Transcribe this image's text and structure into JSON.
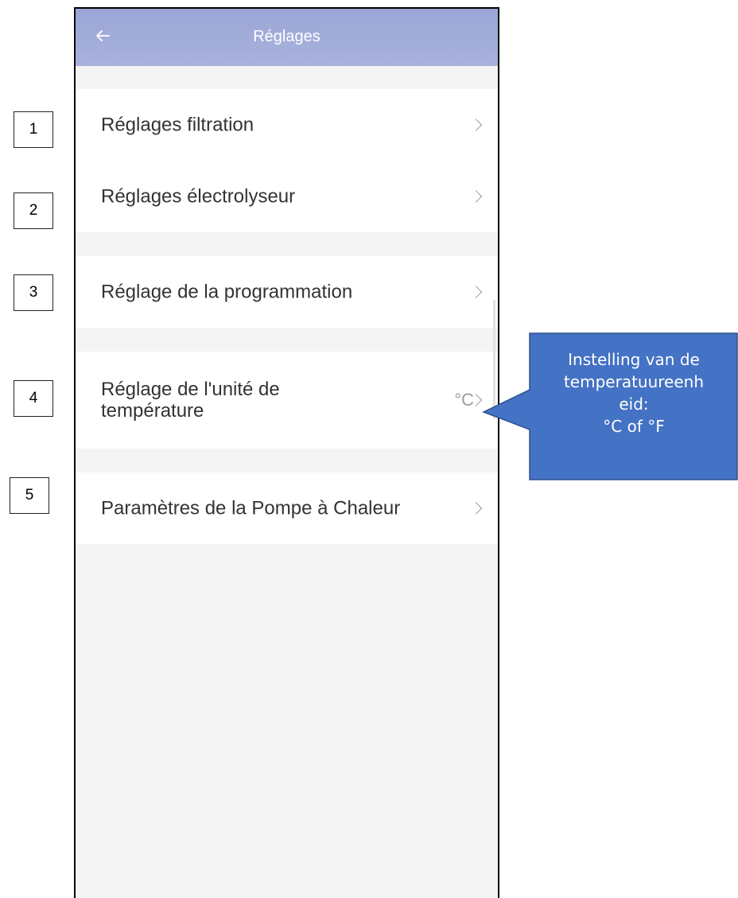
{
  "header": {
    "title": "Réglages"
  },
  "groups": [
    {
      "items": [
        {
          "label": "Réglages filtration",
          "value": ""
        },
        {
          "label": "Réglages électrolyseur",
          "value": ""
        }
      ]
    },
    {
      "items": [
        {
          "label": "Réglage de la programmation",
          "value": ""
        }
      ]
    },
    {
      "items": [
        {
          "label": "Réglage de l'unité de température",
          "value": "°C"
        }
      ]
    },
    {
      "items": [
        {
          "label": "Paramètres de la Pompe à Chaleur",
          "value": ""
        }
      ]
    }
  ],
  "annotations": {
    "numbers": [
      "1",
      "2",
      "3",
      "4",
      "5"
    ],
    "callout": "Instelling van de\ntemperatuureenh\neid:\n°C of °F",
    "callout_color": "#4472c4"
  },
  "colors": {
    "appbar": "#a3addb",
    "background": "#f4f4f4",
    "row_text": "#333333",
    "value_text": "#9a9a9a"
  },
  "icons": {
    "back": "arrow-left-icon",
    "row": "chevron-right-icon"
  }
}
